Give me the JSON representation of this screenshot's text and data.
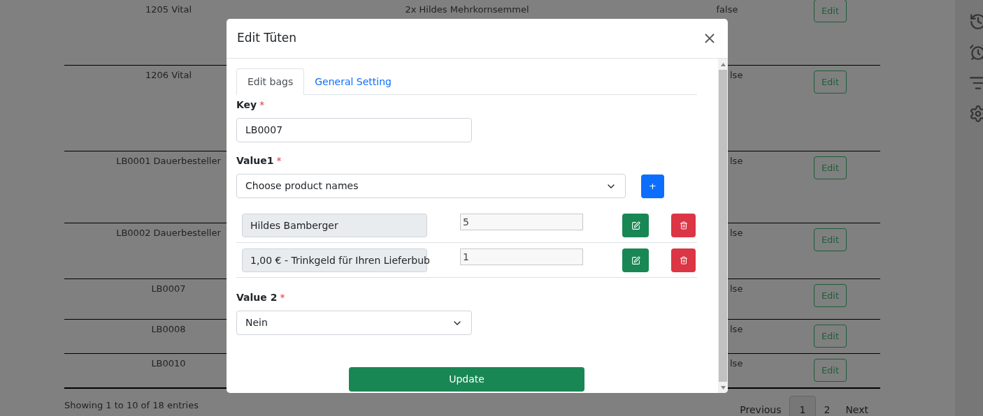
{
  "table": {
    "rows": [
      {
        "column_1": "1205 Vital",
        "column_2": "2x Hildes Mehrkornsemmel",
        "column_3": "false",
        "action": "Edit"
      },
      {
        "column_1": "1206 Vital",
        "column_3": "lse",
        "action": "Edit"
      },
      {
        "column_1": "LB0001 Dauerbesteller",
        "column_3": "lse",
        "action": "Edit"
      },
      {
        "column_1": "LB0002 Dauerbesteller",
        "column_3": "lse",
        "action": "Edit"
      },
      {
        "column_1": "LB0007",
        "column_3": "lse",
        "action": "Edit"
      },
      {
        "column_1": "LB0008",
        "column_3": "lse",
        "action": "Edit"
      },
      {
        "column_1": "LB0010",
        "column_3": "lse",
        "action": "Edit"
      }
    ]
  },
  "footer": {
    "info": "Showing 1 to 10 of 18 entries",
    "pagination": [
      {
        "label": "Previous",
        "selected": false
      },
      {
        "label": "1",
        "selected": true
      },
      {
        "label": "2",
        "selected": false
      },
      {
        "label": "Next",
        "selected": false
      }
    ]
  },
  "modal": {
    "title": "Edit Tüten",
    "tabs": [
      {
        "label": "Edit bags",
        "selected": true
      },
      {
        "label": "General Setting",
        "selected": false
      }
    ],
    "key": {
      "label": "Key",
      "mark": "*",
      "value": "LB0007"
    },
    "value1": {
      "label": "Value1",
      "mark": "*",
      "placeholder": "Choose product names",
      "add_button": "+"
    },
    "items": [
      {
        "product": "Hildes Bamberger",
        "quantity": "5"
      },
      {
        "product": "1,00 € - Trinkgeld für Ihren Lieferbub",
        "quantity": "1"
      }
    ],
    "value2": {
      "label": "Value 2",
      "mark": "*",
      "value": "Nein"
    },
    "submit": "Update"
  }
}
